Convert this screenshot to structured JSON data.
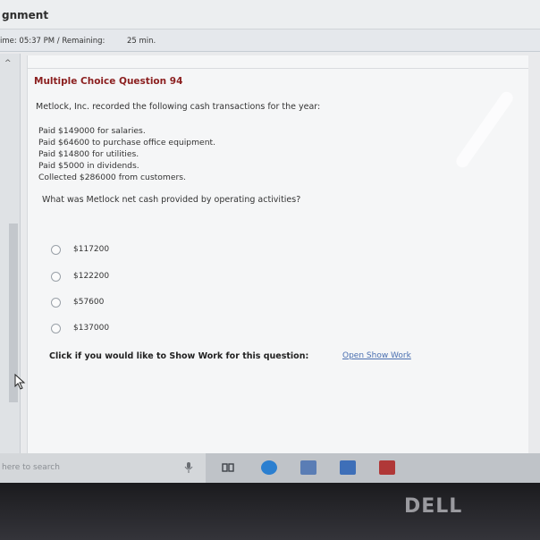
{
  "window": {
    "title": "gnment"
  },
  "timer": {
    "time_label": "ime: 05:37 PM / Remaining:",
    "remaining": "25 min."
  },
  "question": {
    "title": "Multiple Choice Question 94",
    "intro": "Metlock, Inc. recorded the following cash transactions for the year:",
    "transactions": [
      "Paid $149000 for salaries.",
      "Paid $64600 to purchase office equipment.",
      "Paid $14800 for utilities.",
      "Paid $5000 in dividends.",
      "Collected $286000 from customers."
    ],
    "prompt": "What was Metlock net cash provided by operating activities?",
    "choices": [
      "$117200",
      "$122200",
      "$57600",
      "$137000"
    ]
  },
  "show_work": {
    "label": "Click if you would like to Show Work for this question:",
    "link": "Open Show Work"
  },
  "taskbar": {
    "search_placeholder": "here to search",
    "icons": [
      "microphone-icon",
      "task-view-icon",
      "edge-icon",
      "file-explorer-icon",
      "store-icon",
      "office-icon"
    ]
  },
  "monitor": {
    "brand": "DELL"
  },
  "colors": {
    "question_title": "#8b1f1f",
    "link": "#4a6fb0",
    "edge_blue": "#2b7fd0",
    "explorer": "#5a7db5",
    "store": "#3e6fb8",
    "office": "#b03838"
  }
}
